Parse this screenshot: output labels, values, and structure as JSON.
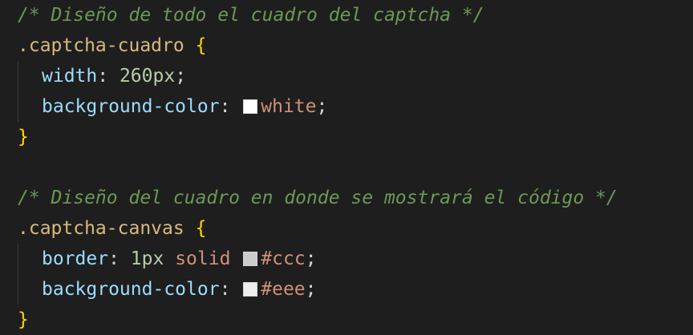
{
  "code": {
    "block1": {
      "comment": "/* Diseño de todo el cuadro del captcha */",
      "selector": ".captcha-cuadro",
      "open_brace": "{",
      "decl1_prop": "width",
      "decl1_value": "260px",
      "decl2_prop": "background-color",
      "decl2_value": "white",
      "decl2_swatch_color": "#ffffff",
      "close_brace": "}"
    },
    "block2": {
      "comment": "/* Diseño del cuadro en donde se mostrará el código */",
      "selector": ".captcha-canvas",
      "open_brace": "{",
      "decl1_prop": "border",
      "decl1_num": "1px",
      "decl1_keyword": "solid",
      "decl1_color": "#ccc",
      "decl1_swatch_color": "#cccccc",
      "decl2_prop": "background-color",
      "decl2_value": "#eee",
      "decl2_swatch_color": "#eeeeee",
      "close_brace": "}"
    }
  },
  "colors": {
    "background": "#1e1e1e",
    "comment": "#6a9955",
    "selector": "#d7ba7d",
    "brace": "#ffd700",
    "property": "#9cdcfe",
    "number": "#b5cea8",
    "string_value": "#ce9178"
  }
}
